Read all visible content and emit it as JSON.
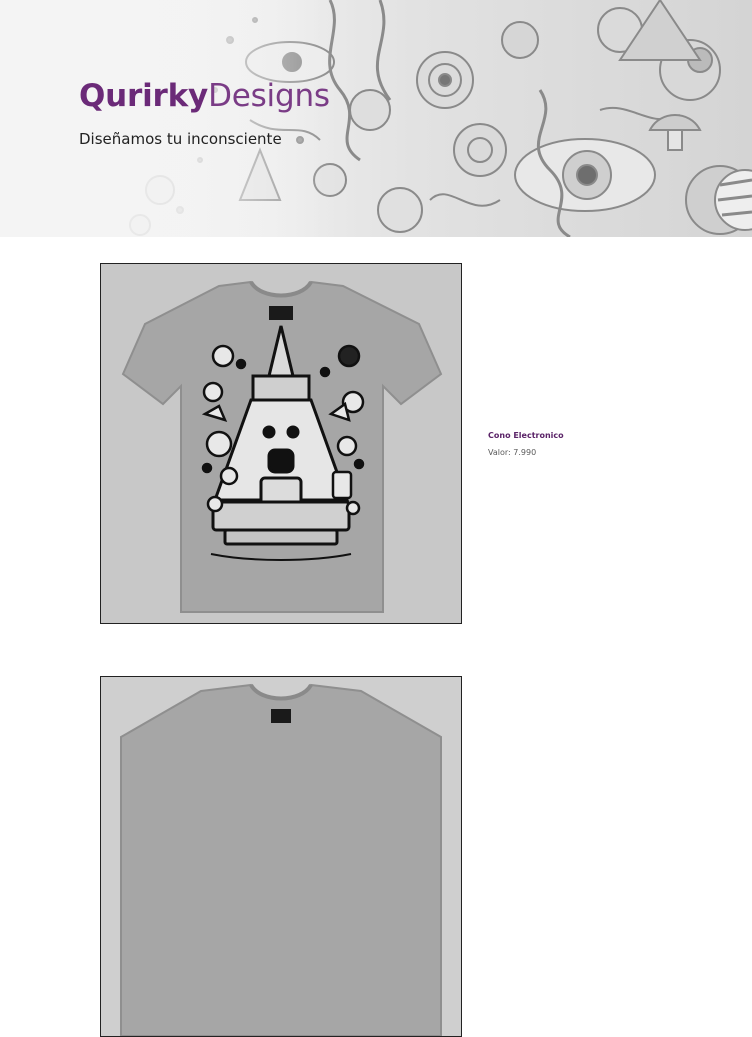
{
  "brand": {
    "name_bold": "Qurirky",
    "name_light": "Designs",
    "tagline": "Diseñamos tu inconsciente"
  },
  "products": [
    {
      "name": "Cono Electronico",
      "price": "Valor: 7.990",
      "image": "tshirt-electronic-cone-print"
    },
    {
      "image": "tshirt-print"
    }
  ],
  "colors": {
    "brand": "#6b2a78",
    "product_name": "#5b2468",
    "price": "#5a5a5a",
    "banner_bg": "#e6e6e6",
    "shirt": "#a6a6a6"
  }
}
